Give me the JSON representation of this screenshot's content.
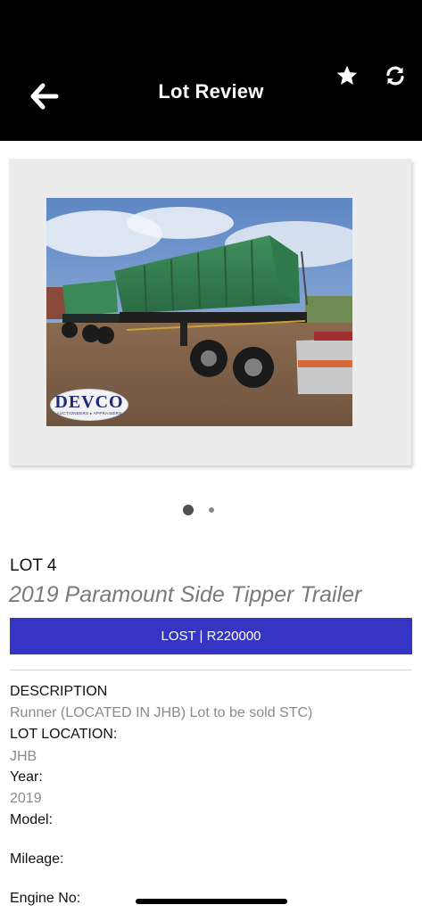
{
  "header": {
    "title": "Lot Review",
    "back_icon": "back-arrow-icon",
    "favorite_icon": "star-icon",
    "refresh_icon": "refresh-icon",
    "background": "#000000"
  },
  "gallery": {
    "image_description_icon": "trailer-photo",
    "watermark": {
      "brand": "DEVCO",
      "tagline": "AUCTIONEERS ▸ APPRAISERS"
    },
    "page_count": 2,
    "active_index": 0
  },
  "lot": {
    "number": "LOT 4",
    "title": "2019 Paramount Side Tipper Trailer",
    "status": "LOST | R220000",
    "status_color": "#3634c3"
  },
  "details": {
    "description_label": "DESCRIPTION",
    "description_value": "Runner (LOCATED IN JHB) Lot to be sold STC)",
    "location_label": "LOT LOCATION:",
    "location_value": "JHB",
    "year_label": "Year:",
    "year_value": "2019",
    "model_label": "Model:",
    "model_value": "",
    "mileage_label": "Mileage:",
    "mileage_value": "",
    "engine_label": "Engine No:",
    "engine_value": ""
  }
}
